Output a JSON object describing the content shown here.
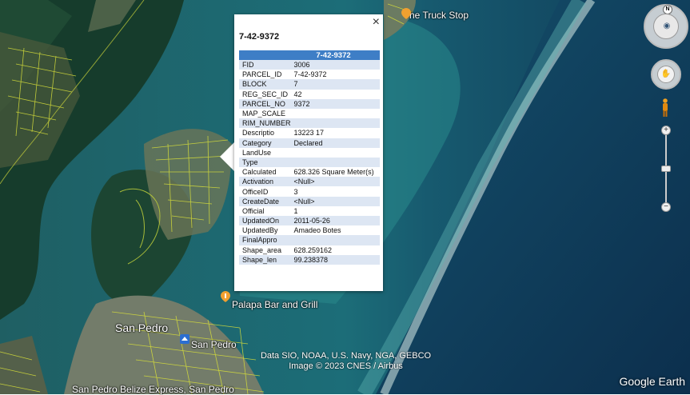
{
  "popup": {
    "title": "7-42-9372",
    "header": "7-42-9372",
    "close_icon": "×",
    "rows": [
      {
        "k": "FID",
        "v": "3006"
      },
      {
        "k": "PARCEL_ID",
        "v": "7-42-9372"
      },
      {
        "k": "BLOCK",
        "v": "7"
      },
      {
        "k": "REG_SEC_ID",
        "v": "42"
      },
      {
        "k": "PARCEL_NO",
        "v": "9372"
      },
      {
        "k": "MAP_SCALE",
        "v": ""
      },
      {
        "k": "RIM_NUMBER",
        "v": ""
      },
      {
        "k": "Descriptio",
        "v": "13223 17"
      },
      {
        "k": "Category",
        "v": "Declared"
      },
      {
        "k": "LandUse",
        "v": ""
      },
      {
        "k": "Type",
        "v": ""
      },
      {
        "k": "Calculated",
        "v": "628.326 Square Meter(s)"
      },
      {
        "k": "Activation",
        "v": "<Null>"
      },
      {
        "k": "OfficeID",
        "v": "3"
      },
      {
        "k": "CreateDate",
        "v": "<Null>"
      },
      {
        "k": "Official",
        "v": "1"
      },
      {
        "k": "UpdatedOn",
        "v": "2011-05-26"
      },
      {
        "k": "UpdatedBy",
        "v": "Amadeo Botes"
      },
      {
        "k": "FinalAppro",
        "v": ""
      },
      {
        "k": "Shape_area",
        "v": "628.259162"
      },
      {
        "k": "Shape_len",
        "v": "99.238378"
      }
    ]
  },
  "places": {
    "truck_stop": "he Truck Stop",
    "palapa": "Palapa Bar and Grill",
    "san_pedro_town": "San Pedro",
    "san_pedro_airport": "San Pedro",
    "express": "San Pedro Belize Express, San Pedro"
  },
  "credits": {
    "line1": "Data SIO, NOAA, U.S. Navy, NGA, GEBCO",
    "line2": "Image © 2023 CNES / Airbus"
  },
  "brand": "Google Earth",
  "controls": {
    "compass_letter": "N",
    "zoom_in": "+",
    "zoom_out": "−"
  }
}
